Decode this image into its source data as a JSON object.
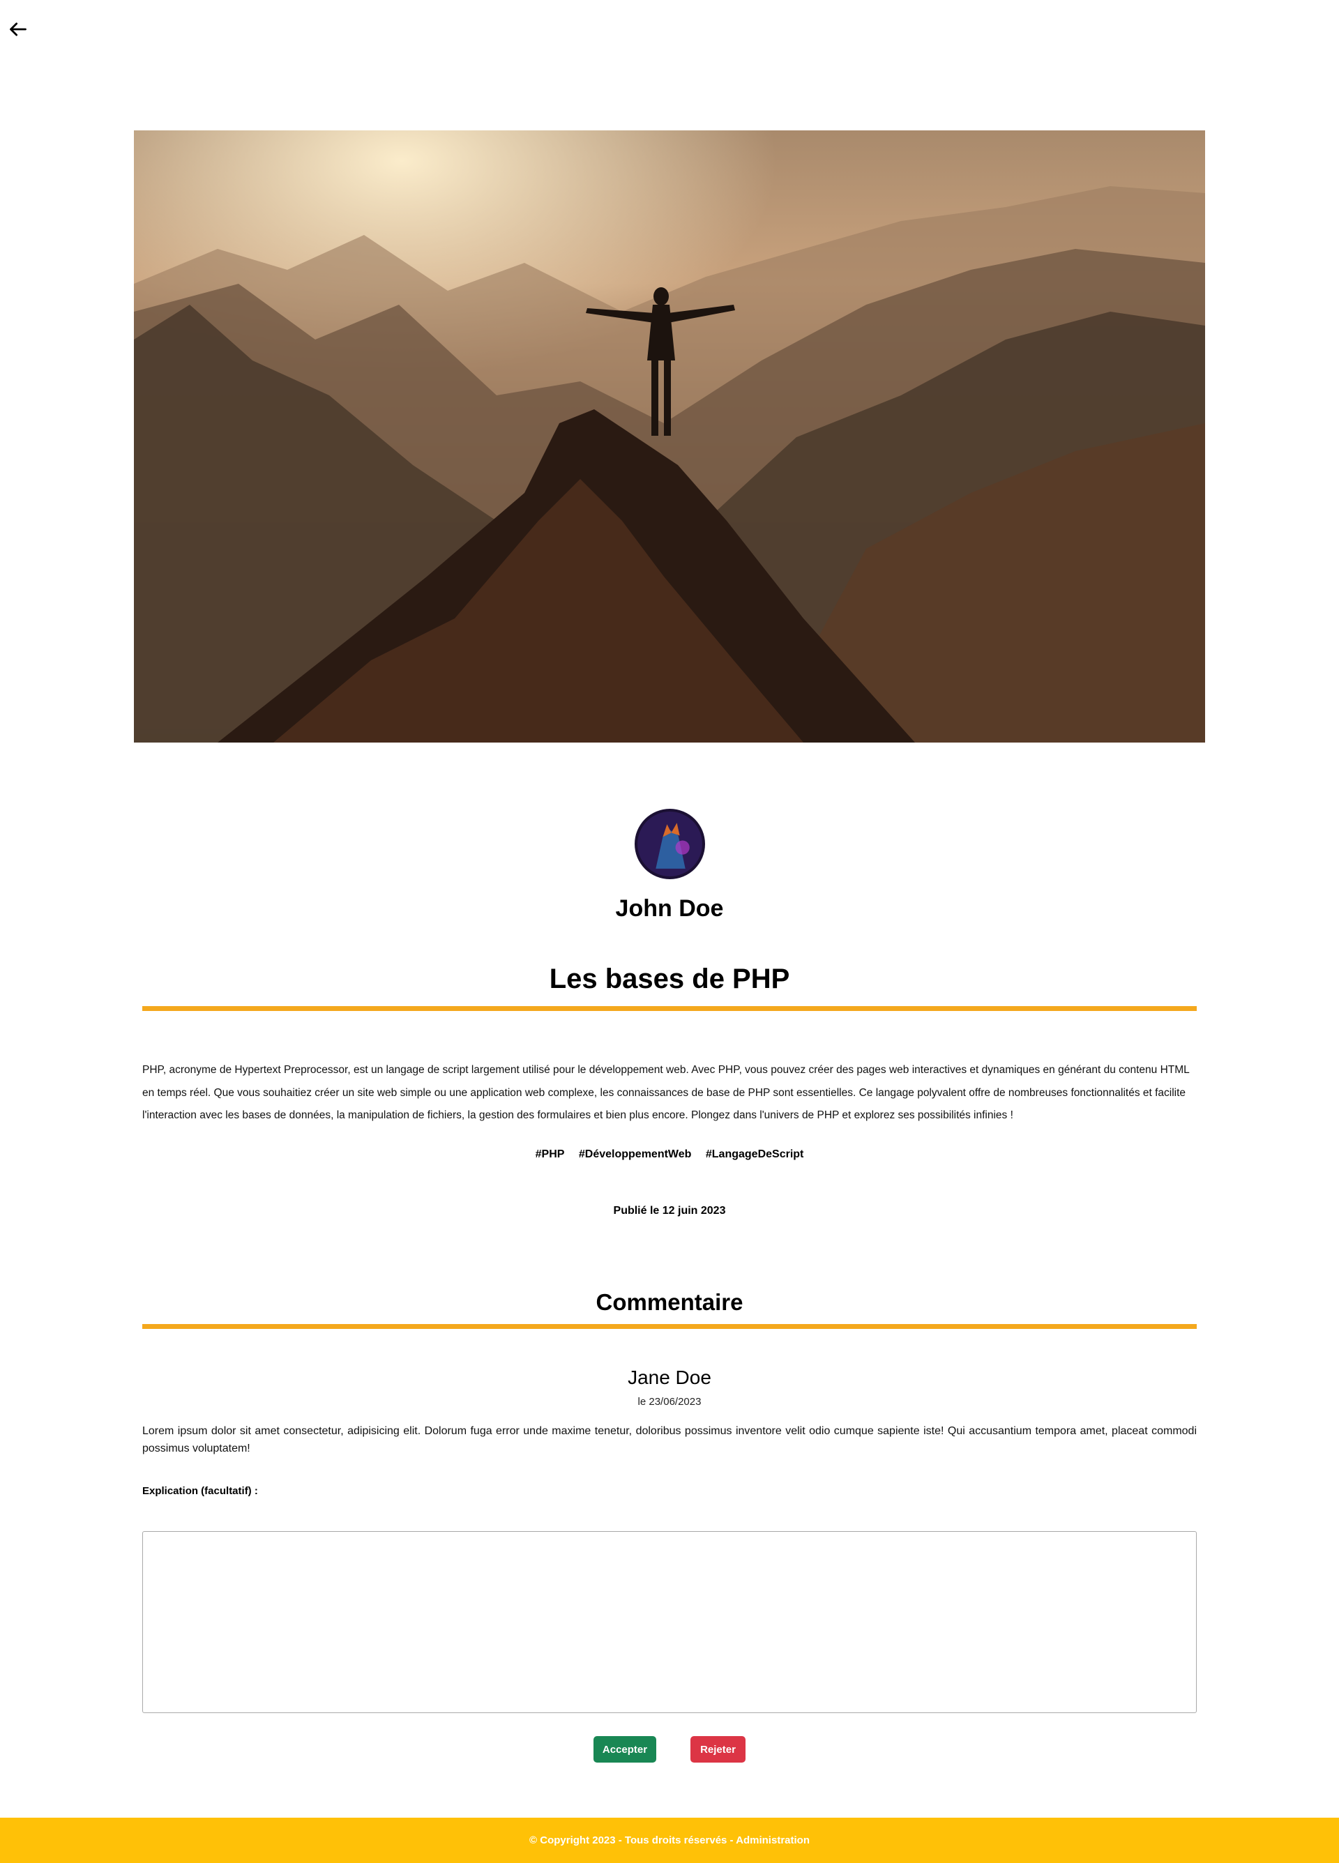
{
  "nav": {
    "back_icon": "arrow-left-icon"
  },
  "hero": {
    "image_name": "mountain-summit-photo"
  },
  "author": {
    "name": "John Doe",
    "avatar_icon": "wolf-avatar"
  },
  "post": {
    "title": "Les bases de PHP",
    "body": "PHP, acronyme de Hypertext Preprocessor, est un langage de script largement utilisé pour le développement web. Avec PHP, vous pouvez créer des pages web interactives et dynamiques en générant du contenu HTML en temps réel. Que vous souhaitiez créer un site web simple ou une application web complexe, les connaissances de base de PHP sont essentielles. Ce langage polyvalent offre de nombreuses fonctionnalités et facilite l'interaction avec les bases de données, la manipulation de fichiers, la gestion des formulaires et bien plus encore. Plongez dans l'univers de PHP et explorez ses possibilités infinies !",
    "tags": [
      "#PHP",
      "#DéveloppementWeb",
      "#LangageDeScript"
    ],
    "published": "Publié le 12 juin 2023"
  },
  "comments": {
    "title": "Commentaire",
    "author": "Jane Doe",
    "date": "le 23/06/2023",
    "text": "Lorem ipsum dolor sit amet consectetur, adipisicing elit. Dolorum fuga error unde maxime tenetur, doloribus possimus inventore velit odio cumque sapiente iste! Qui accusantium tempora amet, placeat commodi possimus voluptatem!",
    "explanation_label": "Explication (facultatif) :",
    "explanation_value": "",
    "accept_label": "Accepter",
    "reject_label": "Rejeter"
  },
  "footer": {
    "text": "© Copyright 2023 - Tous droits réservés - Administration"
  },
  "colors": {
    "accent": "#f4a81d",
    "footer": "#ffc107",
    "accept": "#198754",
    "reject": "#dc3545"
  }
}
